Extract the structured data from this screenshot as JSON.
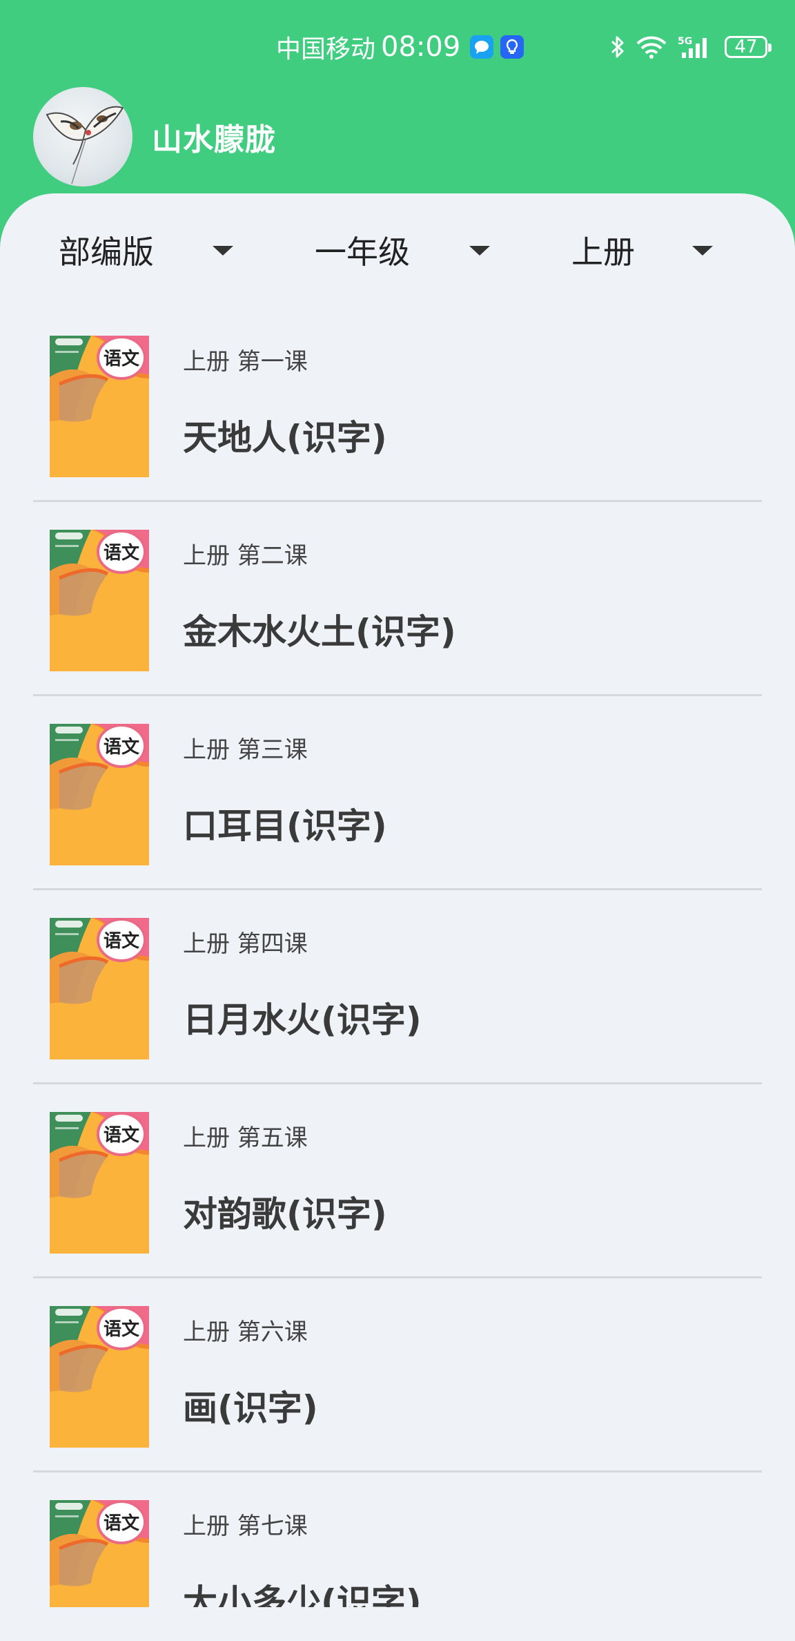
{
  "status_bar": {
    "carrier": "中国移动",
    "time": "08:09",
    "network": "5G",
    "battery": "47"
  },
  "profile": {
    "username": "山水朦胧"
  },
  "filters": [
    {
      "label": "部编版"
    },
    {
      "label": "一年级"
    },
    {
      "label": "上册"
    }
  ],
  "lessons": [
    {
      "meta": "上册  第一课",
      "title": "天地人(识字)",
      "cover_text": "语文"
    },
    {
      "meta": "上册  第二课",
      "title": "金木水火土(识字)",
      "cover_text": "语文"
    },
    {
      "meta": "上册  第三课",
      "title": "口耳目(识字)",
      "cover_text": "语文"
    },
    {
      "meta": "上册  第四课",
      "title": "日月水火(识字)",
      "cover_text": "语文"
    },
    {
      "meta": "上册  第五课",
      "title": "对韵歌(识字)",
      "cover_text": "语文"
    },
    {
      "meta": "上册  第六课",
      "title": "画(识字)",
      "cover_text": "语文"
    },
    {
      "meta": "上册  第七课",
      "title": "大小多少(识字)",
      "cover_text": "语文"
    }
  ],
  "colors": {
    "header_green": "#40cd80",
    "panel_bg": "#eff2f7",
    "cover_orange": "#fbb33b"
  }
}
